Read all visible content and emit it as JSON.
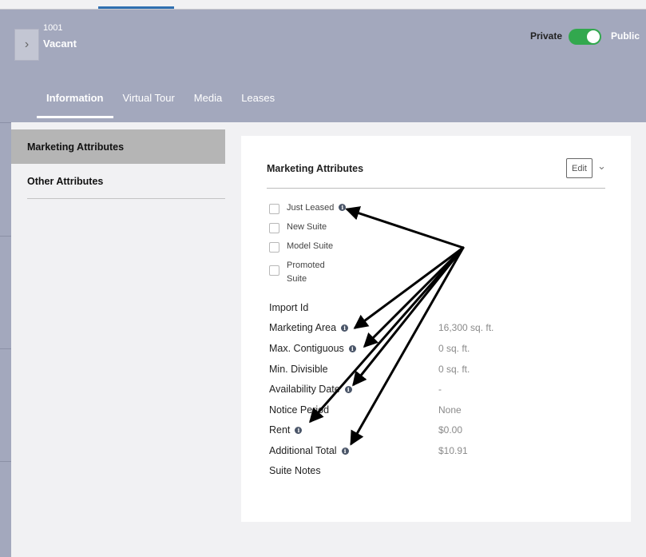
{
  "header": {
    "unit_number": "1001",
    "unit_status": "Vacant",
    "visibility": {
      "private_label": "Private",
      "public_label": "Public",
      "is_public": true
    },
    "collapse_glyph": "›"
  },
  "tabs": [
    {
      "label": "Information",
      "active": true
    },
    {
      "label": "Virtual Tour",
      "active": false
    },
    {
      "label": "Media",
      "active": false
    },
    {
      "label": "Leases",
      "active": false
    }
  ],
  "sidebar": {
    "items": [
      {
        "label": "Marketing Attributes",
        "active": true
      },
      {
        "label": "Other Attributes",
        "active": false
      }
    ]
  },
  "card": {
    "title": "Marketing Attributes",
    "edit_label": "Edit",
    "chevron_glyph": "⌄",
    "checkboxes": [
      {
        "label": "Just Leased",
        "checked": false,
        "info": true
      },
      {
        "label": "New Suite",
        "checked": false,
        "info": false
      },
      {
        "label": "Model Suite",
        "checked": false,
        "info": false
      },
      {
        "label_line1": "Promoted",
        "label_line2": "Suite",
        "checked": false,
        "info": false
      }
    ],
    "attributes": [
      {
        "label": "Import Id",
        "value": "",
        "info": false
      },
      {
        "label": "Marketing Area",
        "value": "16,300 sq. ft.",
        "info": true
      },
      {
        "label": "Max. Contiguous",
        "value": "0 sq. ft.",
        "info": true
      },
      {
        "label": "Min. Divisible",
        "value": "0 sq. ft.",
        "info": false
      },
      {
        "label": "Availability Date",
        "value": "-",
        "info": true
      },
      {
        "label": "Notice Period",
        "value": "None",
        "info": false
      },
      {
        "label": "Rent",
        "value": "$0.00",
        "info": true
      },
      {
        "label": "Additional Total",
        "value": "$10.91",
        "info": true
      },
      {
        "label": "Suite Notes",
        "value": "",
        "info": false
      }
    ],
    "info_glyph": "i"
  },
  "colors": {
    "header_bg": "#a3a8bd",
    "toggle_on": "#32a84e",
    "accent": "#2f6fb0",
    "sidebar_active": "#b5b5b5"
  }
}
